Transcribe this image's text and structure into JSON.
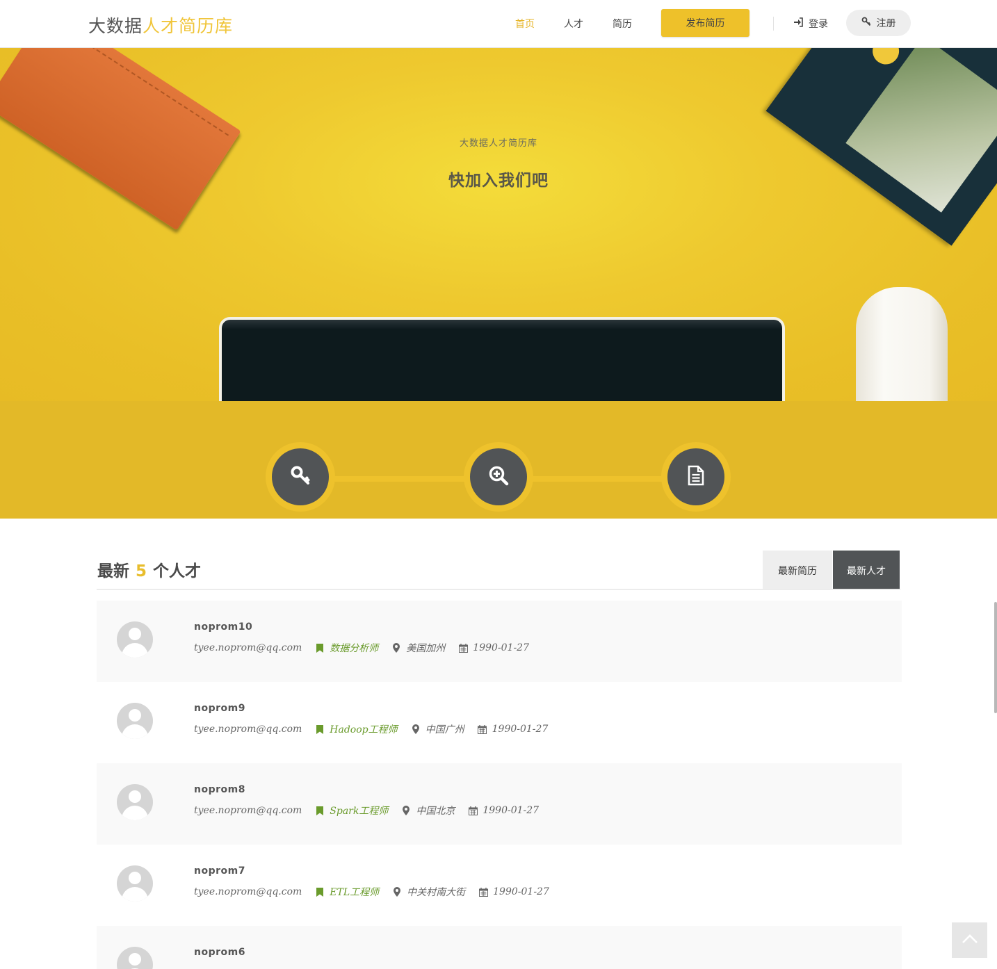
{
  "header": {
    "logo_dark": "大数据",
    "logo_accent": "人才简历库",
    "nav": [
      "首页",
      "人才",
      "简历"
    ],
    "publish_label": "发布简历",
    "login_label": "登录",
    "register_label": "注册"
  },
  "hero": {
    "subtitle": "大数据人才简历库",
    "title": "快加入我们吧"
  },
  "section": {
    "title_prefix": "最新",
    "title_count": "5",
    "title_suffix": "个人才",
    "tabs": [
      "最新简历",
      "最新人才"
    ]
  },
  "talents": [
    {
      "name": "noprom10",
      "email": "tyee.noprom@qq.com",
      "job": "数据分析师",
      "location": "美国加州",
      "birthday": "1990-01-27"
    },
    {
      "name": "noprom9",
      "email": "tyee.noprom@qq.com",
      "job": "Hadoop工程师",
      "location": "中国广州",
      "birthday": "1990-01-27"
    },
    {
      "name": "noprom8",
      "email": "tyee.noprom@qq.com",
      "job": "Spark工程师",
      "location": "中国北京",
      "birthday": "1990-01-27"
    },
    {
      "name": "noprom7",
      "email": "tyee.noprom@qq.com",
      "job": "ETL工程师",
      "location": "中关村南大街",
      "birthday": "1990-01-27"
    },
    {
      "name": "noprom6",
      "email": "",
      "job": "",
      "location": "",
      "birthday": ""
    }
  ],
  "colors": {
    "accent": "#eec12a",
    "job_text": "#6a9b2c",
    "dark_circle": "#515456"
  },
  "icons": {
    "login": "sign-in-icon",
    "register": "key-icon",
    "steps": [
      "key-icon",
      "zoom-in-icon",
      "document-icon"
    ],
    "meta": [
      "bookmark-icon",
      "map-marker-icon",
      "calendar-icon"
    ],
    "to_top": "chevron-up-icon"
  }
}
